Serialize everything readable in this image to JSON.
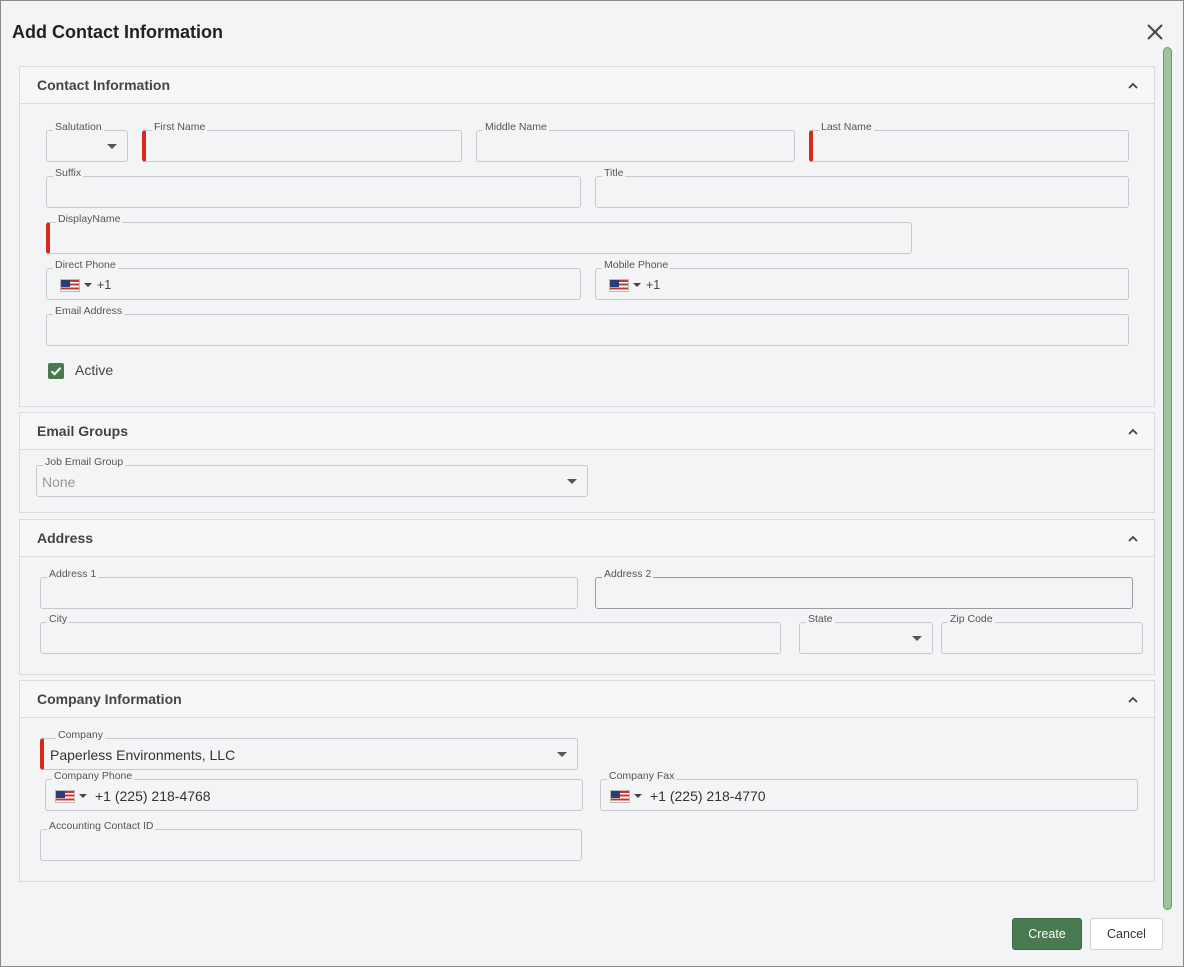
{
  "dialog": {
    "title": "Add Contact Information",
    "close_icon": "close-icon"
  },
  "contact_info": {
    "title": "Contact Information",
    "salutation": {
      "label": "Salutation",
      "value": ""
    },
    "first_name": {
      "label": "First Name",
      "value": "",
      "required": true
    },
    "middle_name": {
      "label": "Middle Name",
      "value": ""
    },
    "last_name": {
      "label": "Last Name",
      "value": "",
      "required": true
    },
    "suffix": {
      "label": "Suffix",
      "value": ""
    },
    "title_field": {
      "label": "Title",
      "value": ""
    },
    "display_name": {
      "label": "DisplayName",
      "value": "",
      "required": true
    },
    "direct_phone": {
      "label": "Direct Phone",
      "dial_code": "+1",
      "value": ""
    },
    "mobile_phone": {
      "label": "Mobile Phone",
      "dial_code": "+1",
      "value": ""
    },
    "email": {
      "label": "Email Address",
      "value": ""
    },
    "active": {
      "label": "Active",
      "checked": true
    }
  },
  "email_groups": {
    "title": "Email Groups",
    "job_email_group": {
      "label": "Job Email Group",
      "value": "None"
    }
  },
  "address": {
    "title": "Address",
    "address1": {
      "label": "Address 1",
      "value": ""
    },
    "address2": {
      "label": "Address 2",
      "value": ""
    },
    "city": {
      "label": "City",
      "value": ""
    },
    "state": {
      "label": "State",
      "value": ""
    },
    "zip": {
      "label": "Zip Code",
      "value": ""
    }
  },
  "company_info": {
    "title": "Company Information",
    "company": {
      "label": "Company",
      "value": "Paperless Environments, LLC",
      "required": true
    },
    "company_phone": {
      "label": "Company Phone",
      "value": "+1 (225) 218-4768"
    },
    "company_fax": {
      "label": "Company Fax",
      "value": "+1 (225) 218-4770"
    },
    "accounting_contact_id": {
      "label": "Accounting Contact ID",
      "value": ""
    }
  },
  "actions": {
    "create": "Create",
    "cancel": "Cancel"
  },
  "colors": {
    "accent": "#4a7a50",
    "required": "#d9291c",
    "scrollbar": "#9dc49a"
  }
}
